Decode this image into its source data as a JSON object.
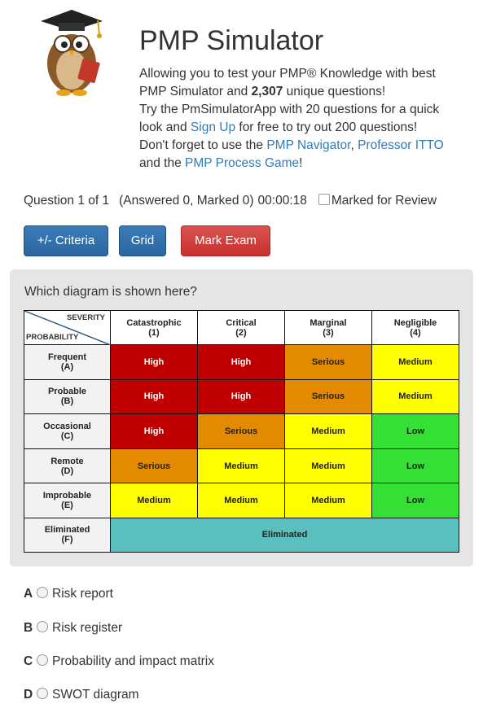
{
  "header": {
    "title": "PMP Simulator",
    "intro_line1_a": "Allowing you to test your PMP® Knowledge with best",
    "intro_line2_a": "PMP Simulator and ",
    "question_count": "2,307",
    "intro_line2_b": " unique questions!",
    "intro_line3": "Try the PmSimulatorApp with 20 questions for a quick",
    "intro_line4_a": "look and ",
    "signup_link": "Sign Up",
    "intro_line4_b": " for free to try out 200 questions!",
    "intro_line5_a": "Don't forget to use the ",
    "navigator_link": "PMP Navigator",
    "comma": ", ",
    "itto_link": "Professor ITTO",
    "intro_line6_a": "and the ",
    "game_link": "PMP Process Game",
    "intro_line6_b": "!"
  },
  "status": {
    "question": "Question 1 of 1",
    "progress": "(Answered 0, Marked 0)",
    "timer": "00:00:18",
    "marked_label": "Marked for Review"
  },
  "buttons": {
    "criteria": "+/- Criteria",
    "grid": "Grid",
    "mark_exam": "Mark Exam"
  },
  "question": {
    "text": "Which diagram is shown here?"
  },
  "matrix": {
    "severity_label": "SEVERITY",
    "probability_label": "PROBABILITY",
    "columns": [
      {
        "name": "Catastrophic",
        "code": "(1)"
      },
      {
        "name": "Critical",
        "code": "(2)"
      },
      {
        "name": "Marginal",
        "code": "(3)"
      },
      {
        "name": "Negligible",
        "code": "(4)"
      }
    ],
    "rows": [
      {
        "name": "Frequent",
        "code": "(A)",
        "cells": [
          "High",
          "High",
          "Serious",
          "Medium"
        ]
      },
      {
        "name": "Probable",
        "code": "(B)",
        "cells": [
          "High",
          "High",
          "Serious",
          "Medium"
        ]
      },
      {
        "name": "Occasional",
        "code": "(C)",
        "cells": [
          "High",
          "Serious",
          "Medium",
          "Low"
        ]
      },
      {
        "name": "Remote",
        "code": "(D)",
        "cells": [
          "Serious",
          "Medium",
          "Medium",
          "Low"
        ]
      },
      {
        "name": "Improbable",
        "code": "(E)",
        "cells": [
          "Medium",
          "Medium",
          "Medium",
          "Low"
        ]
      }
    ],
    "eliminated_row": {
      "name": "Eliminated",
      "code": "(F)",
      "cell": "Eliminated"
    },
    "colors": {
      "High": "#c00000",
      "Serious": "#e38a00",
      "Medium": "#ffff00",
      "Low": "#33e033",
      "Eliminated": "#5bbfbf"
    }
  },
  "options": [
    {
      "letter": "A",
      "text": "Risk report"
    },
    {
      "letter": "B",
      "text": "Risk register"
    },
    {
      "letter": "C",
      "text": "Probability and impact matrix"
    },
    {
      "letter": "D",
      "text": "SWOT diagram"
    }
  ]
}
